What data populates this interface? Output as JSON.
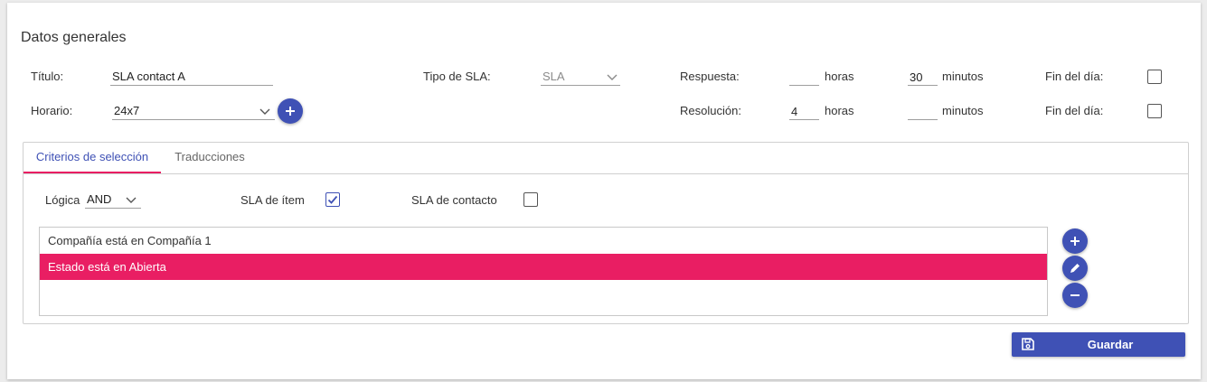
{
  "section_title": "Datos generales",
  "form": {
    "titulo_label": "Título:",
    "titulo_value": "SLA contact A",
    "tipo_label": "Tipo de SLA:",
    "tipo_value": "SLA",
    "respuesta_label": "Respuesta:",
    "respuesta_horas": "",
    "horas_label": "horas",
    "respuesta_minutos": "30",
    "minutos_label": "minutos",
    "fin_dia_label": "Fin del día:",
    "fin_dia_respuesta_checked": false,
    "horario_label": "Horario:",
    "horario_value": "24x7",
    "resolucion_label": "Resolución:",
    "resolucion_horas": "4",
    "resolucion_minutos": "",
    "fin_dia_resolucion_checked": false
  },
  "tabs": [
    {
      "label": "Criterios de selección",
      "active": true
    },
    {
      "label": "Traducciones",
      "active": false
    }
  ],
  "criteria": {
    "logica_label": "Lógica",
    "logica_value": "AND",
    "sla_item_label": "SLA de ítem",
    "sla_item_checked": true,
    "sla_contacto_label": "SLA de contacto",
    "sla_contacto_checked": false,
    "items": [
      {
        "text": "Compañía está en Compañía 1",
        "selected": false
      },
      {
        "text": "Estado está en Abierta",
        "selected": true
      }
    ]
  },
  "actions": {
    "save_label": "Guardar"
  },
  "colors": {
    "primary": "#3f51b5",
    "accent": "#e91e63"
  },
  "icons": {
    "add": "add-icon",
    "edit": "pencil-icon",
    "remove": "minus-icon",
    "save": "floppy-disk-icon",
    "dropdown": "chevron-down-icon"
  }
}
